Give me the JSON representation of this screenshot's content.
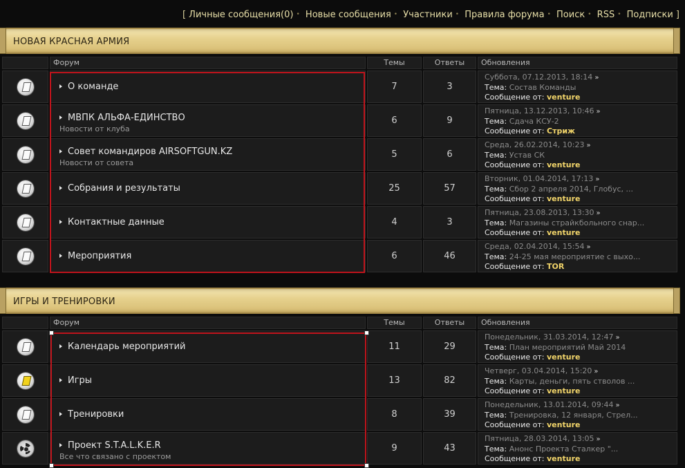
{
  "toplinks": {
    "open": "[",
    "close": "]",
    "items": [
      "Личные сообщения(0)",
      "Новые сообщения",
      "Участники",
      "Правила форума",
      "Поиск",
      "RSS",
      "Подписки"
    ]
  },
  "columns": {
    "forum": "Форум",
    "topics": "Темы",
    "posts": "Ответы",
    "updates": "Обновления"
  },
  "labels": {
    "topic": "Тема:",
    "message_from": "Сообщение от:"
  },
  "categories": [
    {
      "title": "НОВАЯ КРАСНАЯ АРМИЯ",
      "forums": [
        {
          "name": "О команде",
          "desc": "",
          "icon": "forum-read-icon",
          "topics": "7",
          "posts": "3",
          "date": "Суббота, 07.12.2013, 18:14",
          "topic": "Состав Команды",
          "user": "venture"
        },
        {
          "name": "МВПК АЛЬФА-ЕДИНСТВО",
          "desc": "Новости от клуба",
          "icon": "forum-read-icon",
          "topics": "6",
          "posts": "9",
          "date": "Пятница, 13.12.2013, 10:46",
          "topic": "Сдача КСУ-2",
          "user": "Стриж"
        },
        {
          "name": "Совет командиров AIRSOFTGUN.KZ",
          "desc": "Новости от совета",
          "icon": "forum-read-icon",
          "topics": "5",
          "posts": "6",
          "date": "Среда, 26.02.2014, 10:23",
          "topic": "Устав СК",
          "user": "venture"
        },
        {
          "name": "Собрания и результаты",
          "desc": "",
          "icon": "forum-read-icon",
          "topics": "25",
          "posts": "57",
          "date": "Вторник, 01.04.2014, 17:13",
          "topic": "Сбор 2 апреля 2014, Глобус, ...",
          "user": "venture"
        },
        {
          "name": "Контактные данные",
          "desc": "",
          "icon": "forum-read-icon",
          "topics": "4",
          "posts": "3",
          "date": "Пятница, 23.08.2013, 13:30",
          "topic": "Магазины страйкбольного снар...",
          "user": "venture"
        },
        {
          "name": "Мероприятия",
          "desc": "",
          "icon": "forum-read-icon",
          "topics": "6",
          "posts": "46",
          "date": "Среда, 02.04.2014, 15:54",
          "topic": "24-25 мая мероприятие с выхо...",
          "user": "TOR"
        }
      ]
    },
    {
      "title": "ИГРЫ И ТРЕНИРОВКИ",
      "forums": [
        {
          "name": "Календарь мероприятий",
          "desc": "",
          "icon": "forum-read-icon",
          "topics": "11",
          "posts": "29",
          "date": "Понедельник, 31.03.2014, 12:47",
          "topic": "План мероприятий Май 2014",
          "user": "venture"
        },
        {
          "name": "Игры",
          "desc": "",
          "icon": "forum-new-icon",
          "topics": "13",
          "posts": "82",
          "date": "Четверг, 03.04.2014, 15:20",
          "topic": "Карты, деньги, пять стволов ...",
          "user": "venture"
        },
        {
          "name": "Тренировки",
          "desc": "",
          "icon": "forum-read-icon",
          "topics": "8",
          "posts": "39",
          "date": "Понедельник, 13.01.2014, 09:44",
          "topic": "Тренировка, 12 января, Стрел...",
          "user": "venture"
        },
        {
          "name": "Проект S.T.A.L.K.E.R",
          "desc": "Все что связано с проектом",
          "icon": "radiation-icon",
          "topics": "9",
          "posts": "43",
          "date": "Пятница, 28.03.2014, 13:05",
          "topic": "Анонс Проекта Сталкер \"...",
          "user": "venture"
        }
      ]
    }
  ],
  "colors": {
    "accent_user": "#f2d56a",
    "highlight_box": "#c0141c",
    "header_gold": "#e6d18d"
  }
}
